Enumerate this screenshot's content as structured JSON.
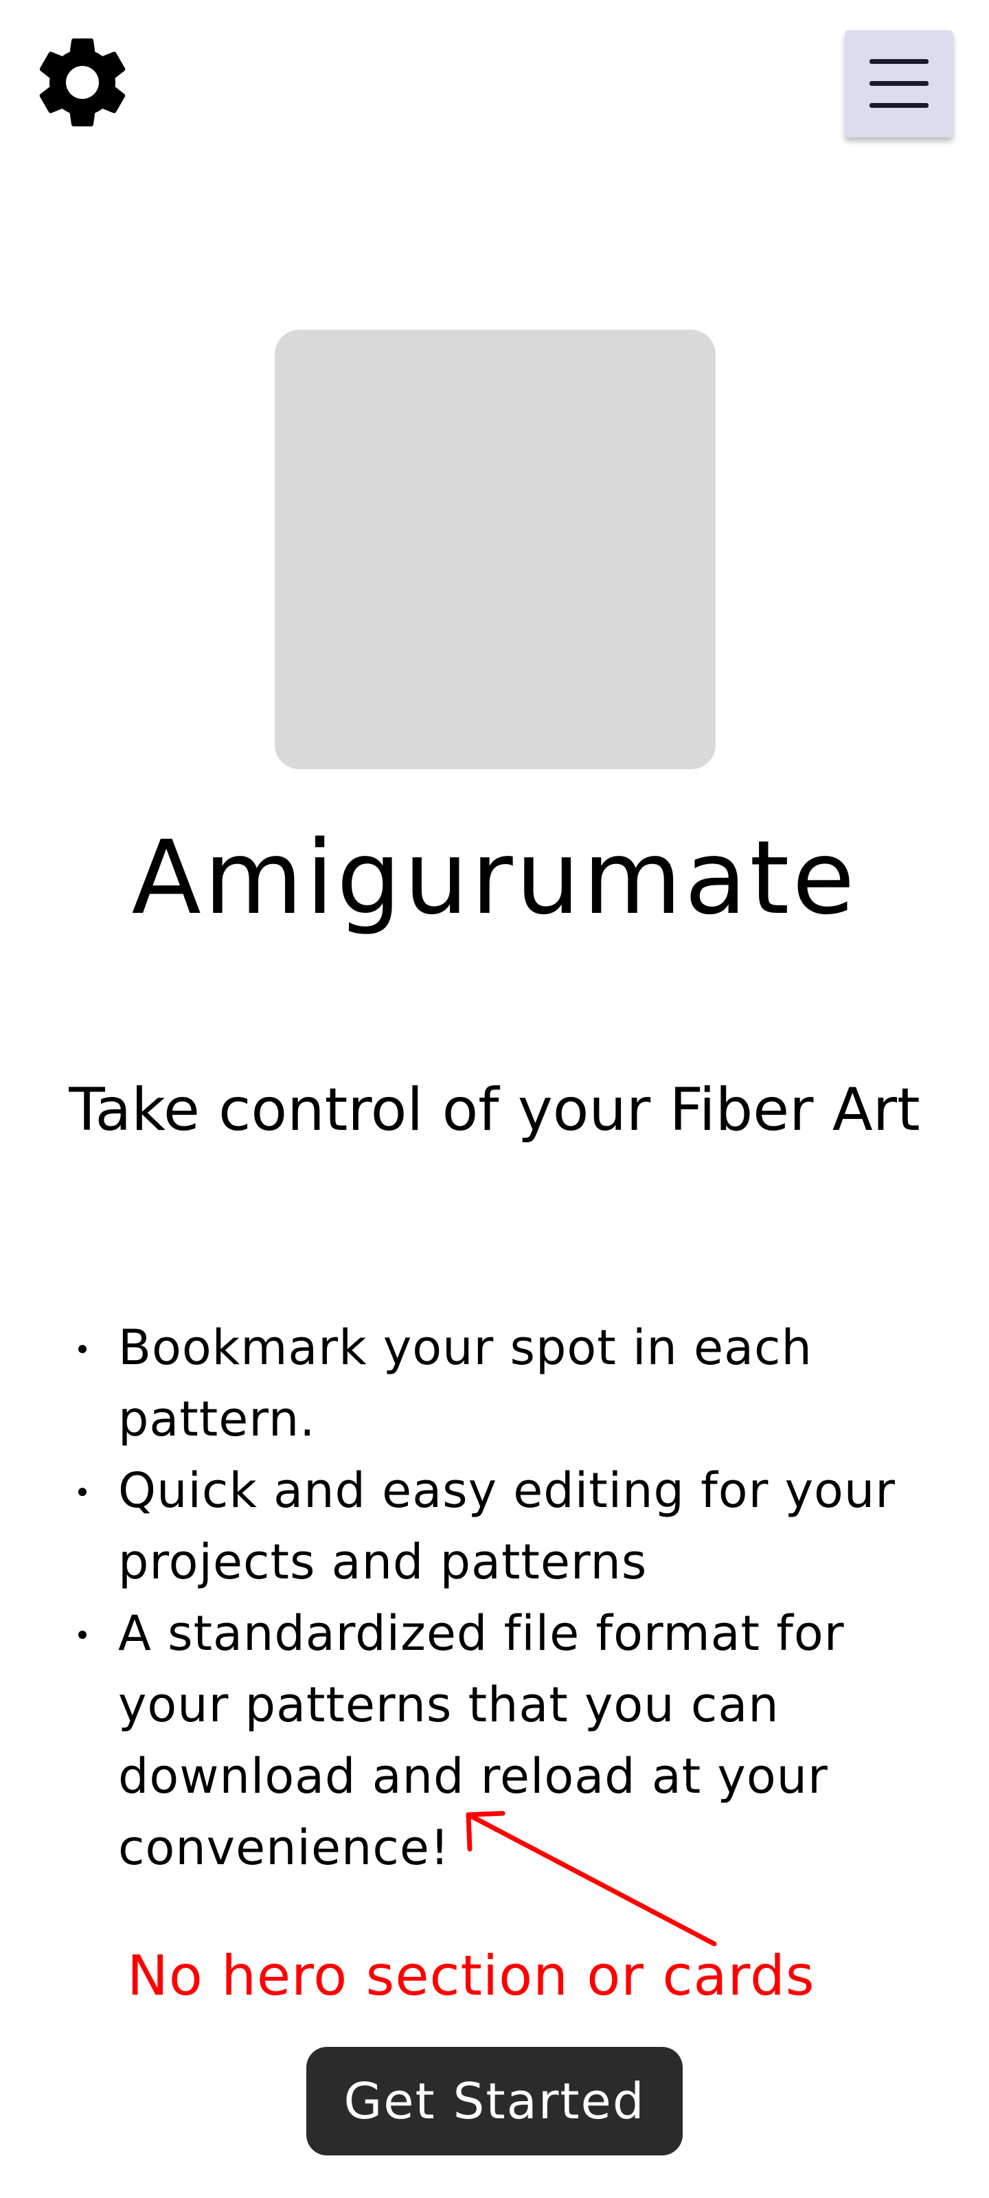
{
  "header": {
    "settings_icon": "gear-icon",
    "menu_icon": "hamburger-menu-icon",
    "menu_button_color": "#dcdcf0"
  },
  "hero": {
    "logo_placeholder_color": "#d9d9d9",
    "title": "Amigurumate",
    "tagline": "Take control of your Fiber Art"
  },
  "features": [
    {
      "text": "Bookmark your spot in each pattern."
    },
    {
      "text": "Quick and easy editing for your projects and patterns"
    },
    {
      "text": "A standardized file format for your patterns that you can download and reload at your convenience!"
    }
  ],
  "annotation": {
    "text": "No hero section or cards",
    "color": "#ff0000"
  },
  "cta": {
    "label": "Get Started",
    "color": "#2b2b2b"
  }
}
